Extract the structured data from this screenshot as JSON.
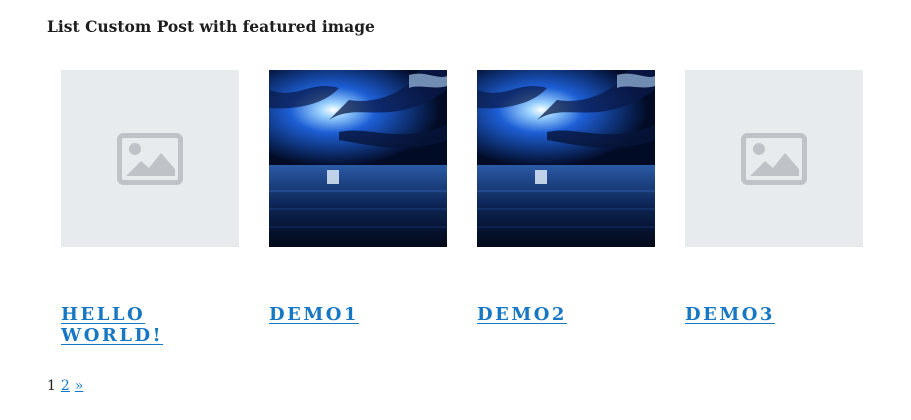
{
  "block": {
    "title": "List Custom Post with featured image"
  },
  "posts": [
    {
      "title": "Hello world!",
      "thumbnail": "placeholder-image-icon"
    },
    {
      "title": "demo1",
      "thumbnail": "night-sea-sky-photo"
    },
    {
      "title": "demo2",
      "thumbnail": "night-sea-sky-photo"
    },
    {
      "title": "demo3",
      "thumbnail": "placeholder-image-icon"
    }
  ],
  "pagination": {
    "current": "1",
    "page2": "2",
    "next": "»"
  },
  "colors": {
    "link": "#1877c5",
    "placeholder_bg": "#e8ebee",
    "placeholder_icon": "#bfc3c7"
  }
}
